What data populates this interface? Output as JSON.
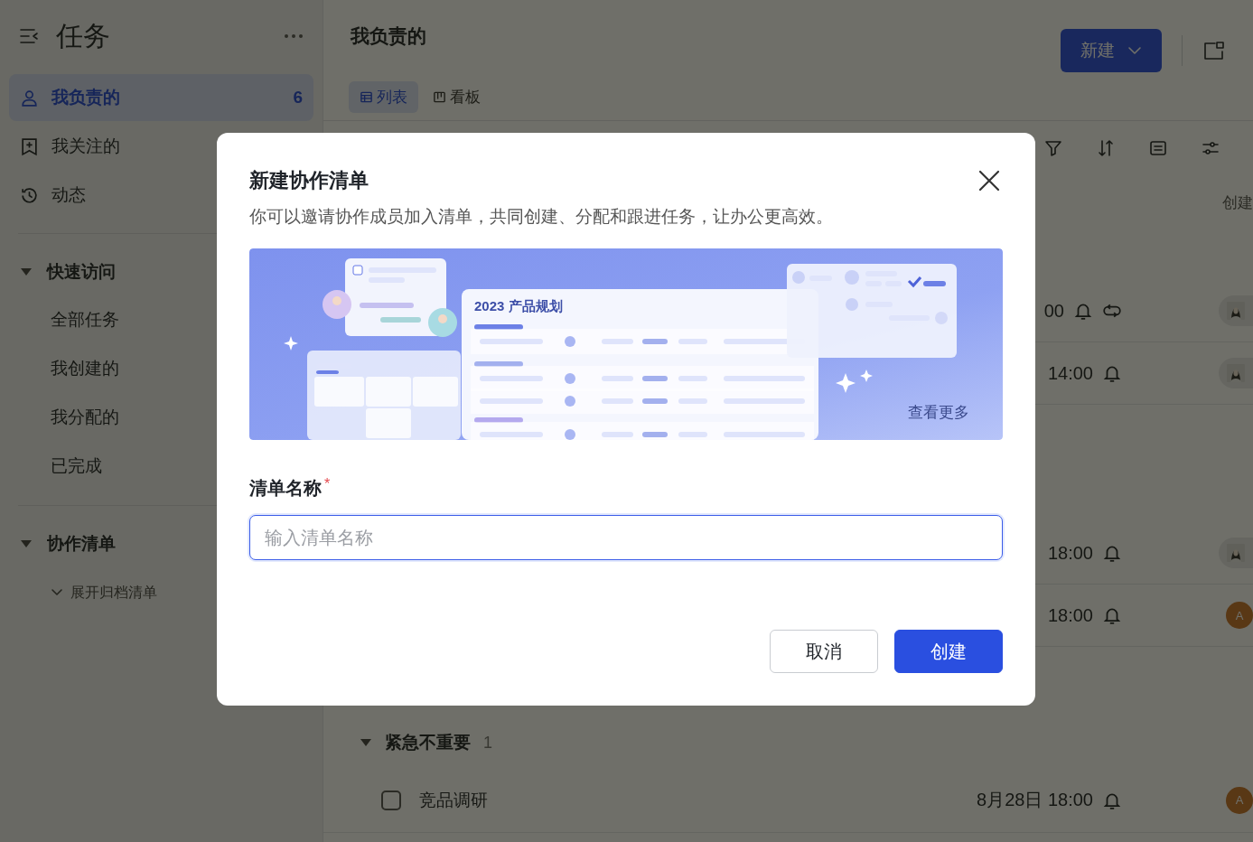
{
  "sidebar": {
    "title": "任务",
    "nav": [
      {
        "label": "我负责的",
        "count": "6",
        "selected": true
      },
      {
        "label": "我关注的",
        "selected": false
      },
      {
        "label": "动态",
        "selected": false
      }
    ],
    "sections": [
      {
        "title": "快速访问",
        "expanded": true,
        "items": [
          "全部任务",
          "我创建的",
          "我分配的",
          "已完成"
        ]
      },
      {
        "title": "协作清单",
        "expanded": true,
        "archive_toggle": "展开归档清单"
      }
    ]
  },
  "main": {
    "title": "我负责的",
    "views": [
      {
        "label": "列表",
        "selected": true
      },
      {
        "label": "看板",
        "selected": false
      }
    ],
    "new_button": "新建",
    "column_header": "创建",
    "rows": [
      {
        "due": "00",
        "reminder": true,
        "repeat": true,
        "avatar": {
          "kind": "photo"
        }
      },
      {
        "due": "14:00",
        "reminder": true,
        "repeat": false,
        "avatar": {
          "kind": "photo"
        }
      },
      {
        "due": "18:00",
        "reminder": true,
        "repeat": false,
        "avatar": {
          "kind": "photo"
        }
      },
      {
        "due": "18:00",
        "reminder": true,
        "repeat": false,
        "avatar": {
          "kind": "letter",
          "initial": "A"
        }
      }
    ],
    "group": {
      "title": "紧急不重要",
      "count": "1",
      "expanded": true,
      "tasks": [
        {
          "title": "竞品调研",
          "checked": false,
          "due": "8月28日 18:00",
          "reminder": true,
          "repeat": false,
          "avatar": {
            "kind": "letter",
            "initial": "A"
          }
        }
      ]
    }
  },
  "dialog": {
    "title": "新建协作清单",
    "description": "你可以邀请协作成员加入清单，共同创建、分配和跟进任务，让办公更高效。",
    "banner": {
      "card_title": "2023 产品规划",
      "link": "查看更多"
    },
    "field": {
      "label": "清单名称",
      "required_mark": "*",
      "placeholder": "输入清单名称",
      "focused": true
    },
    "buttons": [
      {
        "label": "取消",
        "kind": "secondary"
      },
      {
        "label": "创建",
        "kind": "primary"
      }
    ]
  }
}
